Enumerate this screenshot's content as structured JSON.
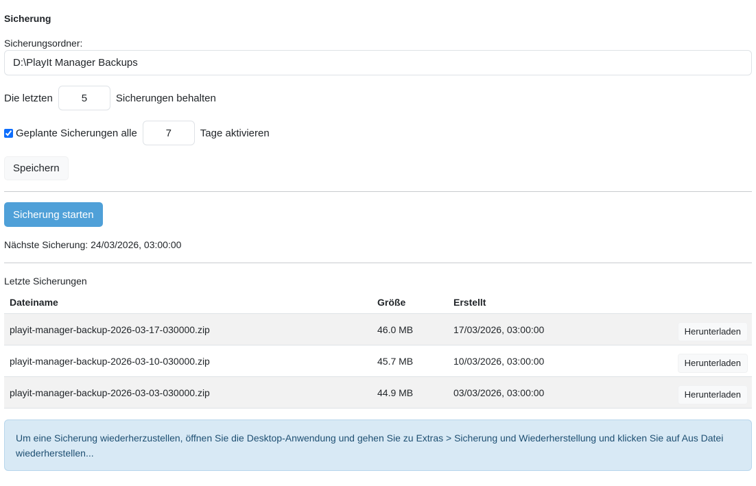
{
  "section_title": "Sicherung",
  "folder": {
    "label": "Sicherungsordner:",
    "value": "D:\\PlayIt Manager Backups"
  },
  "retention": {
    "prefix": "Die letzten",
    "value": "5",
    "suffix": "Sicherungen behalten"
  },
  "schedule": {
    "checked": true,
    "prefix": "Geplante Sicherungen alle",
    "value": "7",
    "suffix": "Tage aktivieren"
  },
  "save_button": "Speichern",
  "start_button": "Sicherung starten",
  "next_backup": "Nächste Sicherung: 24/03/2026, 03:00:00",
  "backups": {
    "title": "Letzte Sicherungen",
    "columns": [
      "Dateiname",
      "Größe",
      "Erstellt"
    ],
    "rows": [
      {
        "name": "playit-manager-backup-2026-03-17-030000.zip",
        "size": "46.0 MB",
        "created": "17/03/2026, 03:00:00",
        "action": "Herunterladen"
      },
      {
        "name": "playit-manager-backup-2026-03-10-030000.zip",
        "size": "45.7 MB",
        "created": "10/03/2026, 03:00:00",
        "action": "Herunterladen"
      },
      {
        "name": "playit-manager-backup-2026-03-03-030000.zip",
        "size": "44.9 MB",
        "created": "03/03/2026, 03:00:00",
        "action": "Herunterladen"
      }
    ]
  },
  "info_text": "Um eine Sicherung wiederherzustellen, öffnen Sie die Desktop-Anwendung und gehen Sie zu Extras > Sicherung und Wiederherstellung und klicken Sie auf Aus Datei wiederherstellen..."
}
